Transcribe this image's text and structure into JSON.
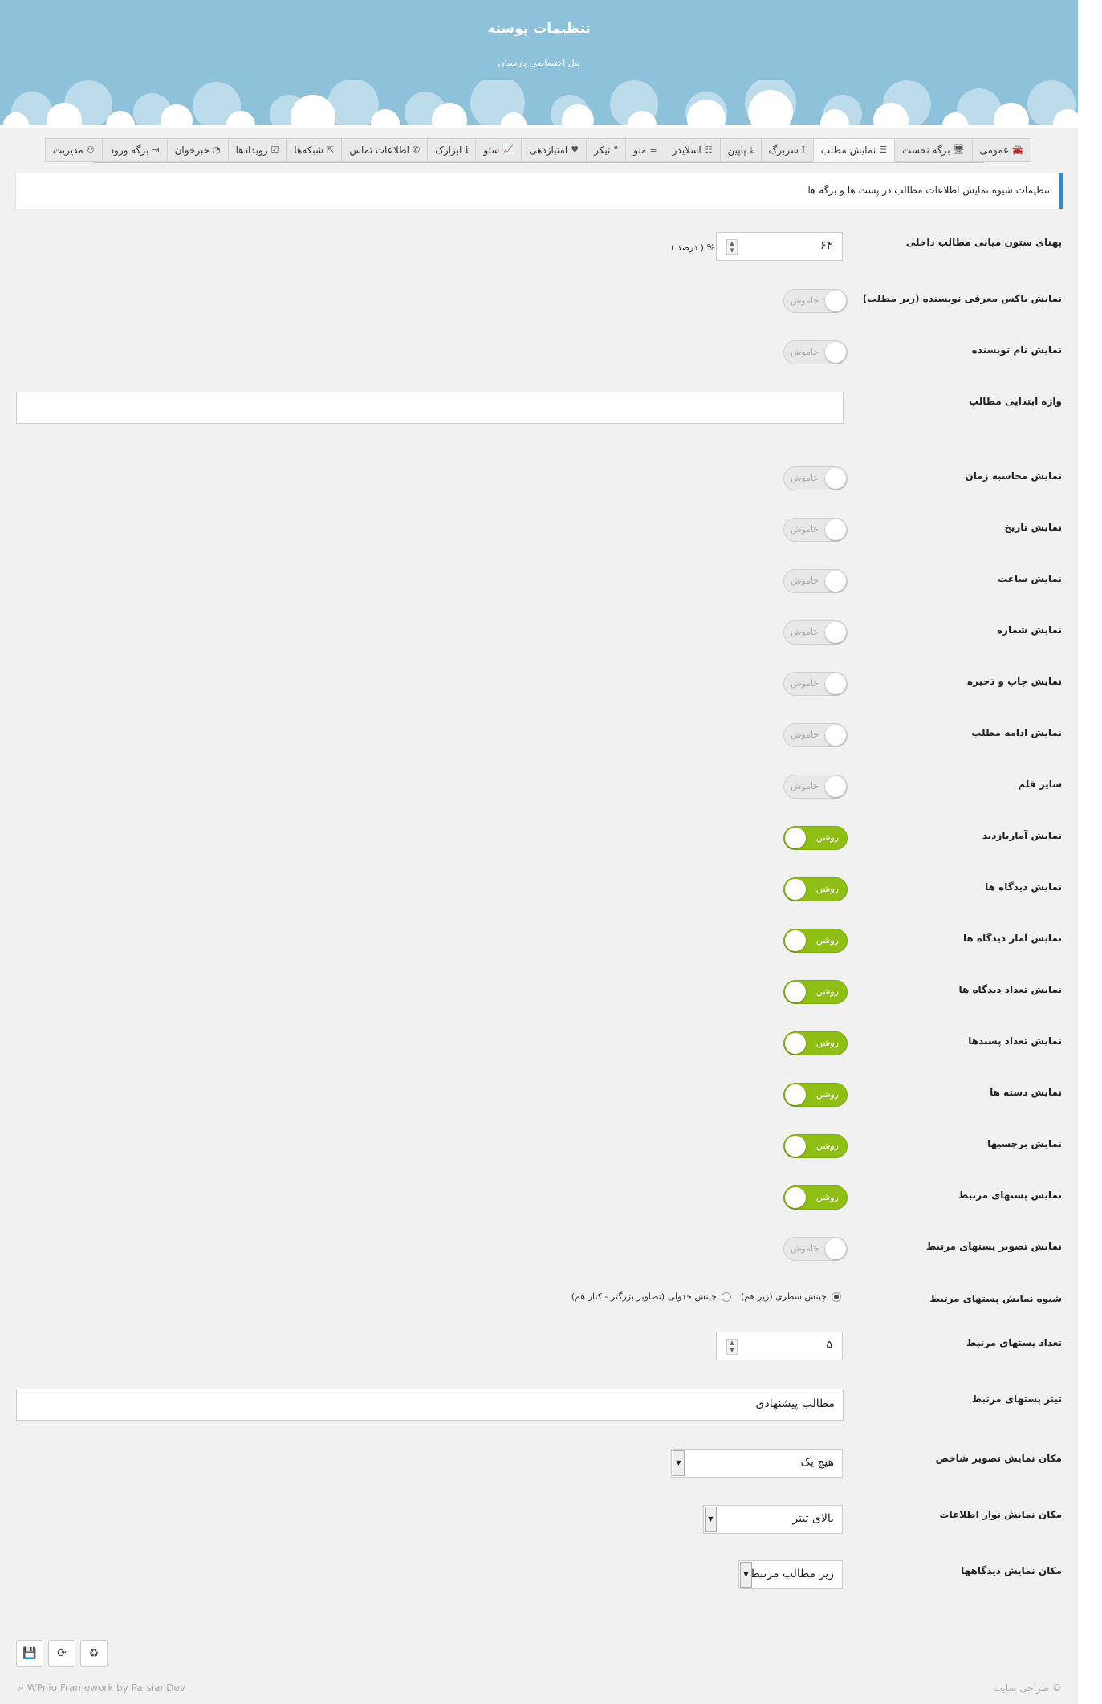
{
  "header": {
    "title": "تنظیمات پوسته",
    "subtitle": "پنل اختصاصی پارسیان"
  },
  "tabs": [
    {
      "label": "عمومی",
      "icon": "car-icon",
      "glyph": "🚘",
      "active": false
    },
    {
      "label": "برگه نخست",
      "icon": "desktop-icon",
      "glyph": "🖥",
      "active": false
    },
    {
      "label": "نمایش مطلب",
      "icon": "list-icon",
      "glyph": "☰",
      "active": true
    },
    {
      "label": "سربرگ",
      "icon": "arrow-up-icon",
      "glyph": "⤒",
      "active": false
    },
    {
      "label": "پاپین",
      "icon": "arrow-down-icon",
      "glyph": "⤓",
      "active": false
    },
    {
      "label": "اسلایدر",
      "icon": "sliders-icon",
      "glyph": "☷",
      "active": false
    },
    {
      "label": "منو",
      "icon": "menu-icon",
      "glyph": "≡",
      "active": false
    },
    {
      "label": "تیکر",
      "icon": "quote-icon",
      "glyph": "❝",
      "active": false
    },
    {
      "label": "امتیازدهی",
      "icon": "heart-icon",
      "glyph": "♥",
      "active": false
    },
    {
      "label": "سئو",
      "icon": "chart-icon",
      "glyph": "📈",
      "active": false
    },
    {
      "label": "ابزارک",
      "icon": "info-icon",
      "glyph": "ℹ",
      "active": false
    },
    {
      "label": "اطلاعات تماس",
      "icon": "phone-icon",
      "glyph": "✆",
      "active": false
    },
    {
      "label": "شبکه‌ها",
      "icon": "share-icon",
      "glyph": "⇱",
      "active": false
    },
    {
      "label": "رویدادها",
      "icon": "calendar-check-icon",
      "glyph": "☑",
      "active": false
    },
    {
      "label": "خبرخوان",
      "icon": "rss-icon",
      "glyph": "◔",
      "active": false
    },
    {
      "label": "برگه ورود",
      "icon": "sign-in-icon",
      "glyph": "⇥",
      "active": false
    },
    {
      "label": "مدیریت",
      "icon": "binoculars-icon",
      "glyph": "⚇",
      "active": false
    }
  ],
  "section_title": "تنظیمات شیوه نمایش اطلاعات مطالب در پست ها و برگه ها",
  "toggle_on_label": "روشن",
  "toggle_off_label": "خاموش",
  "width_field": {
    "label": "پهنای ستون میانی مطالب داخلی",
    "value": "۶۴",
    "unit": "% ( درصد )"
  },
  "author_box": {
    "label": "نمایش باکس معرفی نویسنده (زیر مطلب)",
    "on": false
  },
  "author_name": {
    "label": "نمایش نام نویسنده",
    "on": false
  },
  "intro_word": {
    "label": "واژه ابتدایی مطالب",
    "value": ""
  },
  "toggles": [
    {
      "label": "نمایش محاسبه زمان",
      "on": false
    },
    {
      "label": "نمایش تاریخ",
      "on": false
    },
    {
      "label": "نمایش ساعت",
      "on": false
    },
    {
      "label": "نمایش شماره",
      "on": false
    },
    {
      "label": "نمایش چاپ و ذخیره",
      "on": false
    },
    {
      "label": "نمایش ادامه مطلب",
      "on": false
    },
    {
      "label": "سایز قلم",
      "on": false
    },
    {
      "label": "نمایش آماربازدید",
      "on": true
    },
    {
      "label": "نمایش دیدگاه ها",
      "on": true
    },
    {
      "label": "نمایش آمار دیدگاه ها",
      "on": true
    },
    {
      "label": "نمایش تعداد دیدگاه ها",
      "on": true
    },
    {
      "label": "نمایش تعداد پسندها",
      "on": true
    },
    {
      "label": "نمایش دسته ها",
      "on": true
    },
    {
      "label": "نمایش برچسبها",
      "on": true
    },
    {
      "label": "نمایش پستهای مرتبط",
      "on": true
    },
    {
      "label": "نمایش تصویر پستهای مرتبط",
      "on": false
    }
  ],
  "related_style": {
    "label": "شیوه نمایش پستهای مرتبط",
    "option_1": "چینش سطری (زیر هم)",
    "option_2": "چینش جدولی (تصاویر بزرگتر - کنار هم)",
    "selected": 1
  },
  "related_count": {
    "label": "تعداد پستهای مرتبط",
    "value": "۵"
  },
  "related_title": {
    "label": "تیتر پستهای مرتبط",
    "value": "مطالب پیشنهادی"
  },
  "thumb_position": {
    "label": "مکان نمایش تصویر شاخص",
    "value": "هیچ یک"
  },
  "info_bar_position": {
    "label": "مکان نمایش نوار اطلاعات",
    "value": "بالای تیتر"
  },
  "comments_position": {
    "label": "مکان نمایش دیدگاهها",
    "value": "زیر مطالب مرتبط"
  },
  "footer": {
    "credit": "WPnio Framework by ParsianDev",
    "copyright": "© طراحی سایت"
  },
  "colors": {
    "header": "#8dc2da",
    "toggle_on": "#8fbf14",
    "accent": "#2b8ad8"
  }
}
